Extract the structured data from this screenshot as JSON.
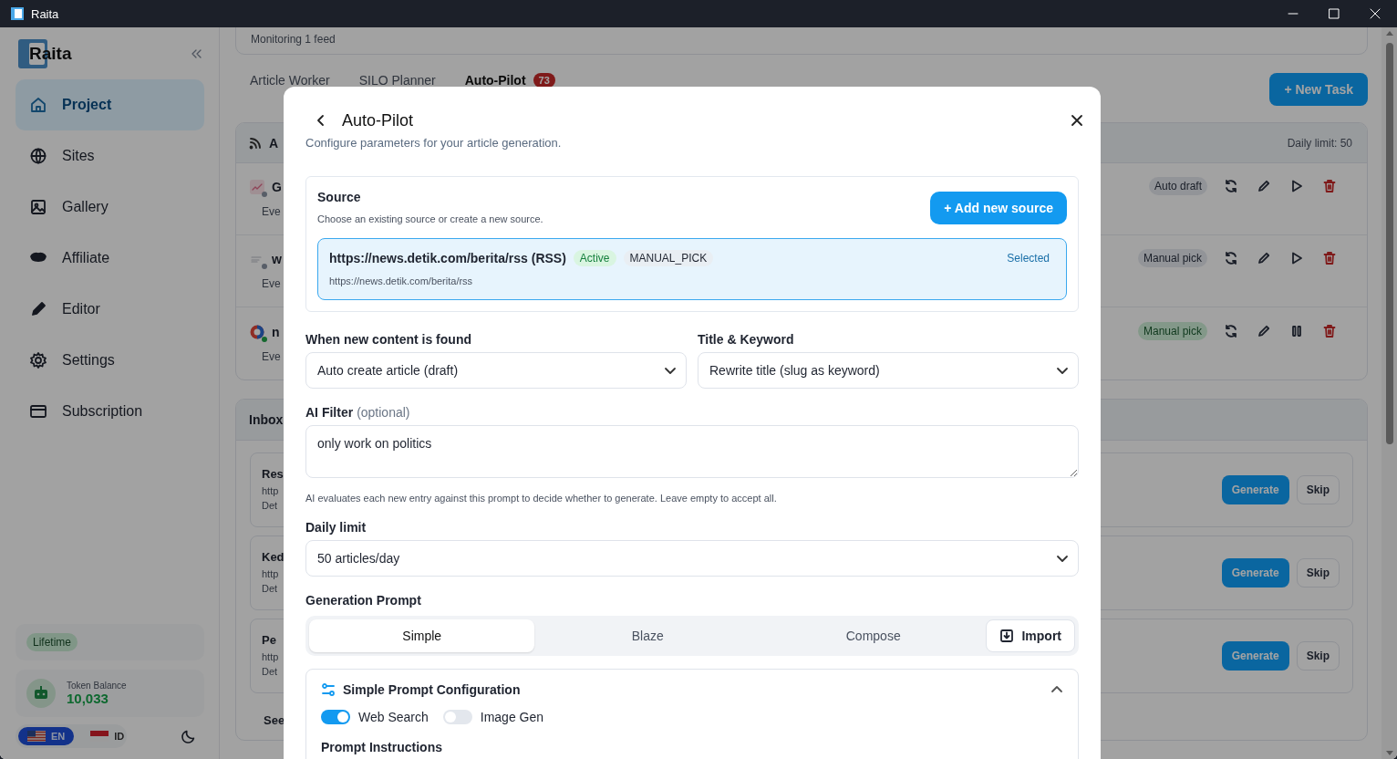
{
  "window": {
    "title": "Raita"
  },
  "sidebar": {
    "logo": "Raita",
    "items": [
      {
        "label": "Project",
        "selected": true
      },
      {
        "label": "Sites",
        "selected": false
      },
      {
        "label": "Gallery",
        "selected": false
      },
      {
        "label": "Affiliate",
        "selected": false
      },
      {
        "label": "Editor",
        "selected": false
      },
      {
        "label": "Settings",
        "selected": false
      },
      {
        "label": "Subscription",
        "selected": false
      }
    ],
    "plan": "Lifetime",
    "token_balance": {
      "label": "Token Balance",
      "value": "10,033"
    },
    "languages": [
      {
        "code": "EN",
        "selected": true
      },
      {
        "code": "ID",
        "selected": false
      }
    ]
  },
  "main": {
    "monitor_text": "Monitoring 1 feed",
    "tabs": [
      {
        "label": "Article Worker",
        "selected": false
      },
      {
        "label": "SILO Planner",
        "selected": false
      },
      {
        "label": "Auto-Pilot",
        "selected": true,
        "badge": "73"
      }
    ],
    "new_task": "+ New Task",
    "feeds": {
      "title": "A",
      "daily_limit": "Daily limit: 50",
      "rows": [
        {
          "name": "G",
          "schedule": "Eve",
          "mode": "Auto draft",
          "active": false
        },
        {
          "name": "w",
          "schedule": "Eve",
          "mode": "Manual pick",
          "active": false
        },
        {
          "name": "n",
          "schedule": "Eve",
          "mode": "Manual pick",
          "active": true
        }
      ]
    },
    "inbox": {
      "title": "Inbox",
      "items": [
        {
          "title": "Res",
          "url": "http",
          "meta": "Det",
          "generate": "Generate",
          "skip": "Skip"
        },
        {
          "title": "Ked",
          "url": "http",
          "meta": "Det",
          "generate": "Generate",
          "skip": "Skip"
        },
        {
          "title": "Pe",
          "url": "http",
          "meta": "Det",
          "generate": "Generate",
          "skip": "Skip"
        }
      ],
      "see_more": "See"
    }
  },
  "dialog": {
    "title": "Auto-Pilot",
    "subtitle": "Configure parameters for your article generation.",
    "source": {
      "title": "Source",
      "description": "Choose an existing source or create a new source.",
      "add_button": "+ Add new source",
      "items": [
        {
          "name": "https://news.detik.com/berita/rss (RSS)",
          "status": "Active",
          "mode": "MANUAL_PICK",
          "url": "https://news.detik.com/berita/rss",
          "selected": true,
          "selected_label": "Selected"
        }
      ]
    },
    "selects": [
      {
        "label": "When new content is found",
        "value": "Auto create article (draft)"
      },
      {
        "label": "Title & Keyword",
        "value": "Rewrite title (slug as keyword)"
      }
    ],
    "ai_filter": {
      "label": "AI Filter",
      "hint": "(optional)",
      "value": "only work on politics",
      "help": "AI evaluates each new entry against this prompt to decide whether to generate. Leave empty to accept all."
    },
    "daily_limit": {
      "label": "Daily limit",
      "value": "50 articles/day"
    },
    "generation_prompt": {
      "label": "Generation Prompt",
      "tabs": [
        {
          "label": "Simple",
          "selected": true
        },
        {
          "label": "Blaze",
          "selected": false
        },
        {
          "label": "Compose",
          "selected": false
        }
      ],
      "import": "Import"
    },
    "config": {
      "title": "Simple Prompt Configuration",
      "expanded": true,
      "toggles": [
        {
          "label": "Web Search",
          "on": true
        },
        {
          "label": "Image Gen",
          "on": false
        }
      ],
      "instructions_label": "Prompt Instructions"
    }
  }
}
